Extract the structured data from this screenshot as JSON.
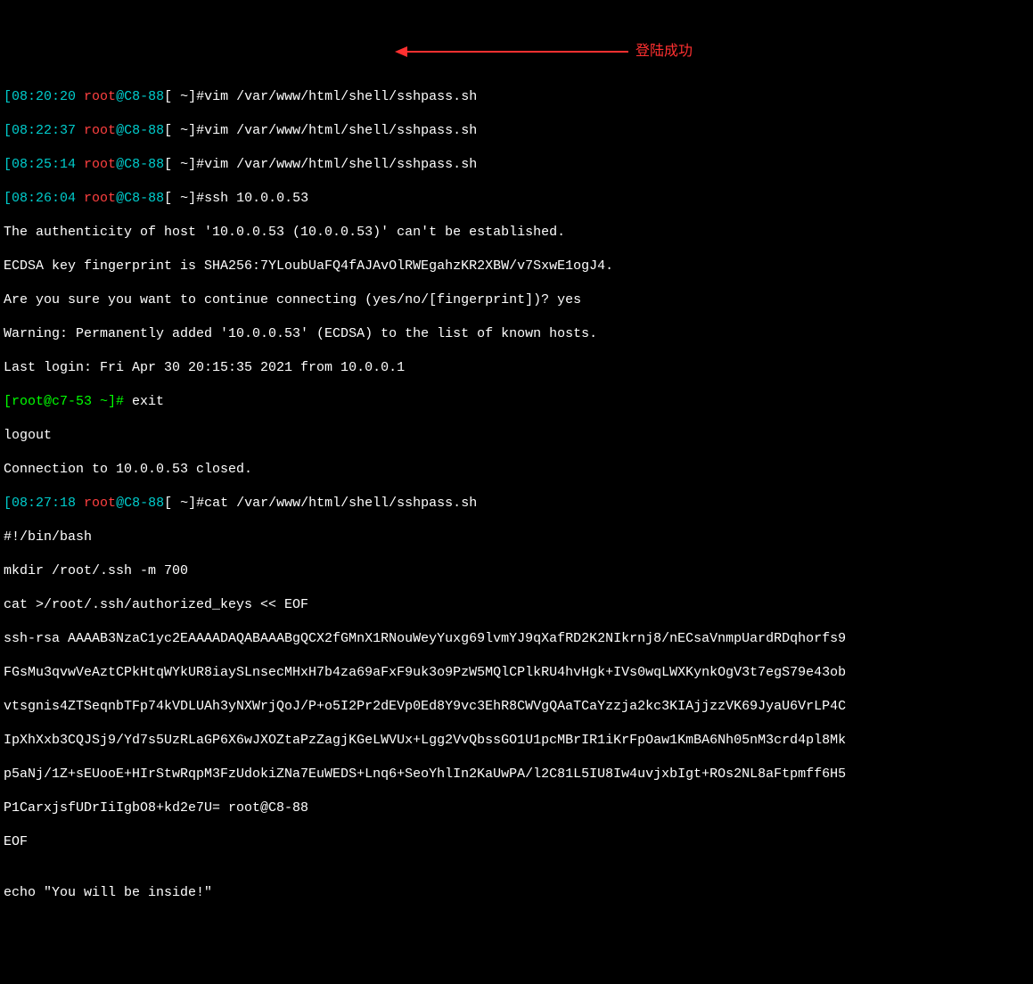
{
  "annotation": {
    "label": "登陆成功"
  },
  "prompts": [
    {
      "time": "08:20:20",
      "user": "root",
      "at": "@",
      "host": "C8-88",
      "bracket_close": "[",
      "tilde": " ~",
      "close": "]#",
      "cmd": "vim /var/www/html/shell/sshpass.sh"
    },
    {
      "time": "08:22:37",
      "user": "root",
      "at": "@",
      "host": "C8-88",
      "bracket_close": "[",
      "tilde": " ~",
      "close": "]#",
      "cmd": "vim /var/www/html/shell/sshpass.sh"
    },
    {
      "time": "08:25:14",
      "user": "root",
      "at": "@",
      "host": "C8-88",
      "bracket_close": "[",
      "tilde": " ~",
      "close": "]#",
      "cmd": "vim /var/www/html/shell/sshpass.sh"
    },
    {
      "time": "08:26:04",
      "user": "root",
      "at": "@",
      "host": "C8-88",
      "bracket_close": "[",
      "tilde": " ~",
      "close": "]#",
      "cmd": "ssh 10.0.0.53"
    }
  ],
  "ssh": {
    "auth_line": "The authenticity of host '10.0.0.53 (10.0.0.53)' can't be established.",
    "fp_line": "ECDSA key fingerprint is SHA256:7YLoubUaFQ4fAJAvOlRWEgahzKR2XBW/v7SxwE1ogJ4.",
    "confirm_line": "Are you sure you want to continue connecting (yes/no/[fingerprint])? yes",
    "warn_line": "Warning: Permanently added '10.0.0.53' (ECDSA) to the list of known hosts.",
    "last_login": "Last login: Fri Apr 30 20:15:35 2021 from 10.0.0.1"
  },
  "remote_prompt": {
    "full": "[root@c7-53 ~]#",
    "cmd": " exit"
  },
  "logout": {
    "l1": "logout",
    "l2": "Connection to 10.0.0.53 closed."
  },
  "cat_prompt": {
    "time": "08:27:18",
    "user": "root",
    "at": "@",
    "host": "C8-88",
    "bracket_close": "[",
    "tilde": " ~",
    "close": "]#",
    "cmd": "cat /var/www/html/shell/sshpass.sh"
  },
  "script": {
    "shebang": "#!/bin/bash",
    "mkdir": "mkdir /root/.ssh -m 700",
    "cat_hdr": "cat >/root/.ssh/authorized_keys << EOF",
    "key_lines": [
      "ssh-rsa AAAAB3NzaC1yc2EAAAADAQABAAABgQCX2fGMnX1RNouWeyYuxg69lvmYJ9qXafRD2K2NIkrnj8/nECsaVnmpUardRDqhorfs9",
      "FGsMu3qvwVeAztCPkHtqWYkUR8iaySLnsecMHxH7b4za69aFxF9uk3o9PzW5MQlCPlkRU4hvHgk+IVs0wqLWXKynkOgV3t7egS79e43ob",
      "vtsgnis4ZTSeqnbTFp74kVDLUAh3yNXWrjQoJ/P+o5I2Pr2dEVp0Ed8Y9vc3EhR8CWVgQAaTCaYzzja2kc3KIAjjzzVK69JyaU6VrLP4C",
      "IpXhXxb3CQJSj9/Yd7s5UzRLaGP6X6wJXOZtaPzZagjKGeLWVUx+Lgg2VvQbssGO1U1pcMBrIR1iKrFpOaw1KmBA6Nh05nM3crd4pl8Mk",
      "p5aNj/1Z+sEUooE+HIrStwRqpM3FzUdokiZNa7EuWEDS+Lnq6+SeoYhlIn2KaUwPA/l2C81L5IU8Iw4uvjxbIgt+ROs2NL8aFtpmff6H5",
      "P1CarxjsfUDrIiIgbO8+kd2e7U= root@C8-88"
    ],
    "eof": "EOF",
    "blank": "",
    "echo": "echo \"You will be inside!\""
  }
}
